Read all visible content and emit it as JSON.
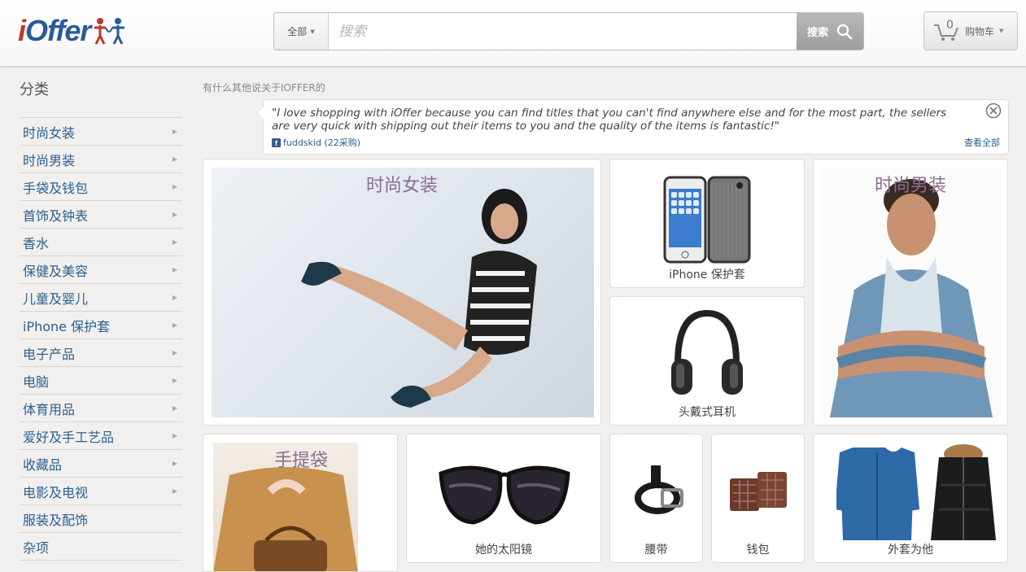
{
  "header": {
    "logo_text": "iOffer",
    "search": {
      "scope_label": "全部",
      "placeholder": "搜索",
      "button_label": "搜索"
    },
    "cart": {
      "count": "0",
      "label": "购物车"
    }
  },
  "sidebar": {
    "title": "分类",
    "items": [
      {
        "label": "时尚女装"
      },
      {
        "label": "时尚男装"
      },
      {
        "label": "手袋及钱包"
      },
      {
        "label": "首饰及钟表"
      },
      {
        "label": "香水"
      },
      {
        "label": "保健及美容"
      },
      {
        "label": "儿童及婴儿"
      },
      {
        "label": "iPhone 保护套"
      },
      {
        "label": "电子产品"
      },
      {
        "label": "电脑"
      },
      {
        "label": "体育用品"
      },
      {
        "label": "爱好及手工艺品"
      },
      {
        "label": "收藏品"
      },
      {
        "label": "电影及电视"
      },
      {
        "label": "服装及配饰"
      },
      {
        "label": "杂项"
      }
    ]
  },
  "testimonial": {
    "heading": "有什么其他说关于IOFFER的",
    "quote": "\"I love shopping with iOffer because you can find titles that you can't find anywhere else and for the most part, the sellers are very quick with shipping out their items to you and the quality of the items is fantastic!\"",
    "author": "fuddskid (22采购)",
    "view_all": "查看全部"
  },
  "tiles": {
    "womens": {
      "title": "时尚女装"
    },
    "iphone": {
      "caption": "iPhone 保护套"
    },
    "headphones": {
      "caption": "头戴式耳机"
    },
    "mens": {
      "title": "时尚男装"
    },
    "handbags": {
      "title": "手提袋"
    },
    "sunglasses": {
      "caption": "她的太阳镜"
    },
    "belts": {
      "caption": "腰带"
    },
    "wallets": {
      "caption": "钱包"
    },
    "jackets": {
      "caption": "外套为他"
    }
  },
  "colors": {
    "link_blue": "#2b5f8f",
    "tile_title": "#8b6e8f",
    "logo_red": "#c0392b",
    "logo_blue": "#2a5a9a"
  }
}
